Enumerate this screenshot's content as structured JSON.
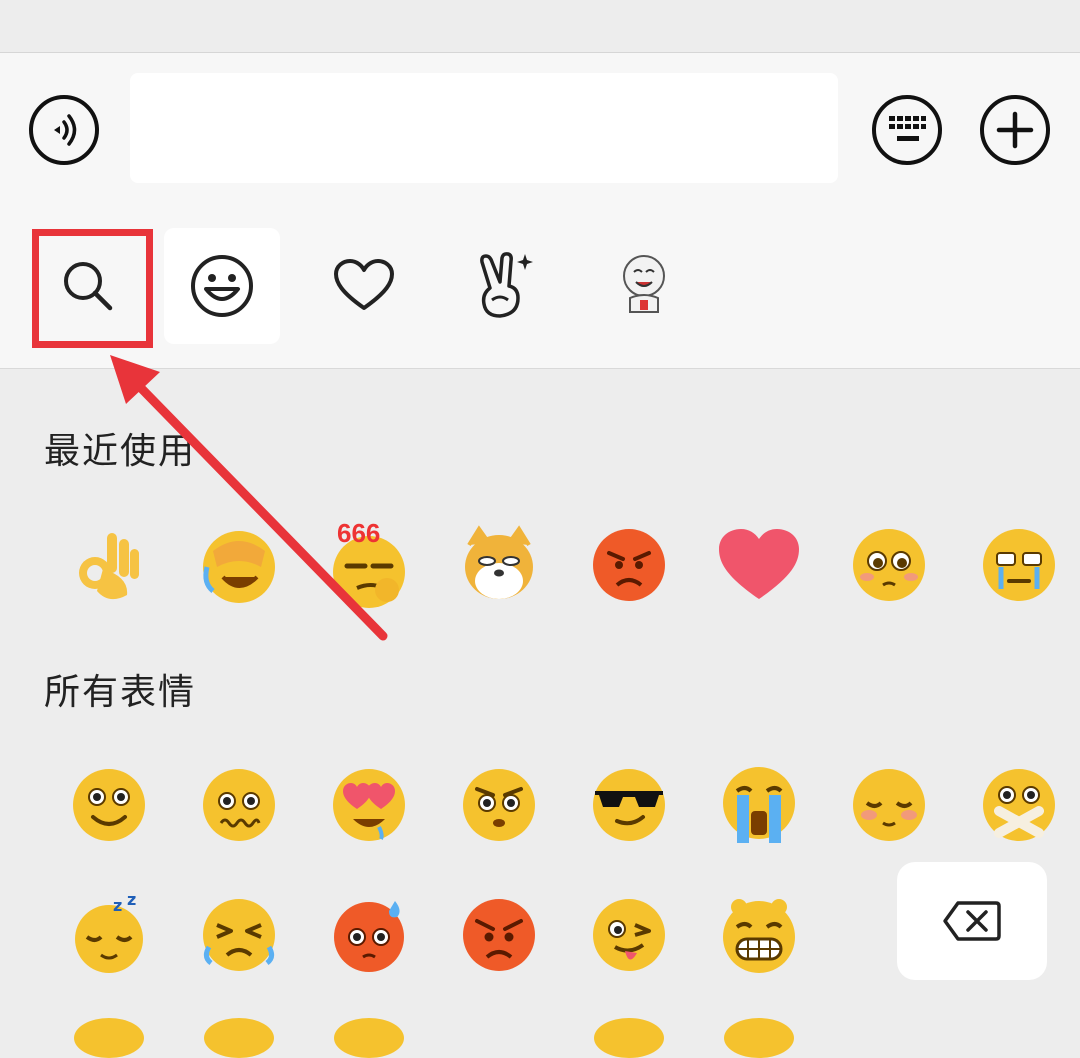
{
  "input_bar": {
    "voice_button": "voice-icon",
    "text_value": "",
    "keyboard_button": "keyboard-icon",
    "more_button": "plus-icon"
  },
  "tabs": [
    {
      "icon": "search-icon",
      "active": false
    },
    {
      "icon": "smiley-icon",
      "active": true
    },
    {
      "icon": "heart-icon",
      "active": false
    },
    {
      "icon": "victory-hand-icon",
      "active": false
    },
    {
      "icon": "sticker-pack-icon",
      "active": false
    }
  ],
  "sections": {
    "recent_title": "最近使用",
    "all_title": "所有表情"
  },
  "recent_badge_text": "666",
  "recent": [
    "ok-hand",
    "facepalm-laugh",
    "666-smirk",
    "doge",
    "angry",
    "heart",
    "pleading",
    "tearful-grin"
  ],
  "all_row1": [
    "smile",
    "awkward",
    "heart-eyes",
    "angry-stare",
    "cool-sunglasses",
    "crying",
    "shy",
    "silent"
  ],
  "all_row2": [
    "sleepy",
    "tears-of-pain",
    "sweat",
    "angry-red",
    "tongue-wink",
    "grin"
  ],
  "colors": {
    "highlight": "#e8343a",
    "emoji_yellow": "#f5c22e",
    "panel_bg": "#ededed",
    "bar_bg": "#f7f7f7"
  },
  "backspace_icon": "backspace-icon"
}
